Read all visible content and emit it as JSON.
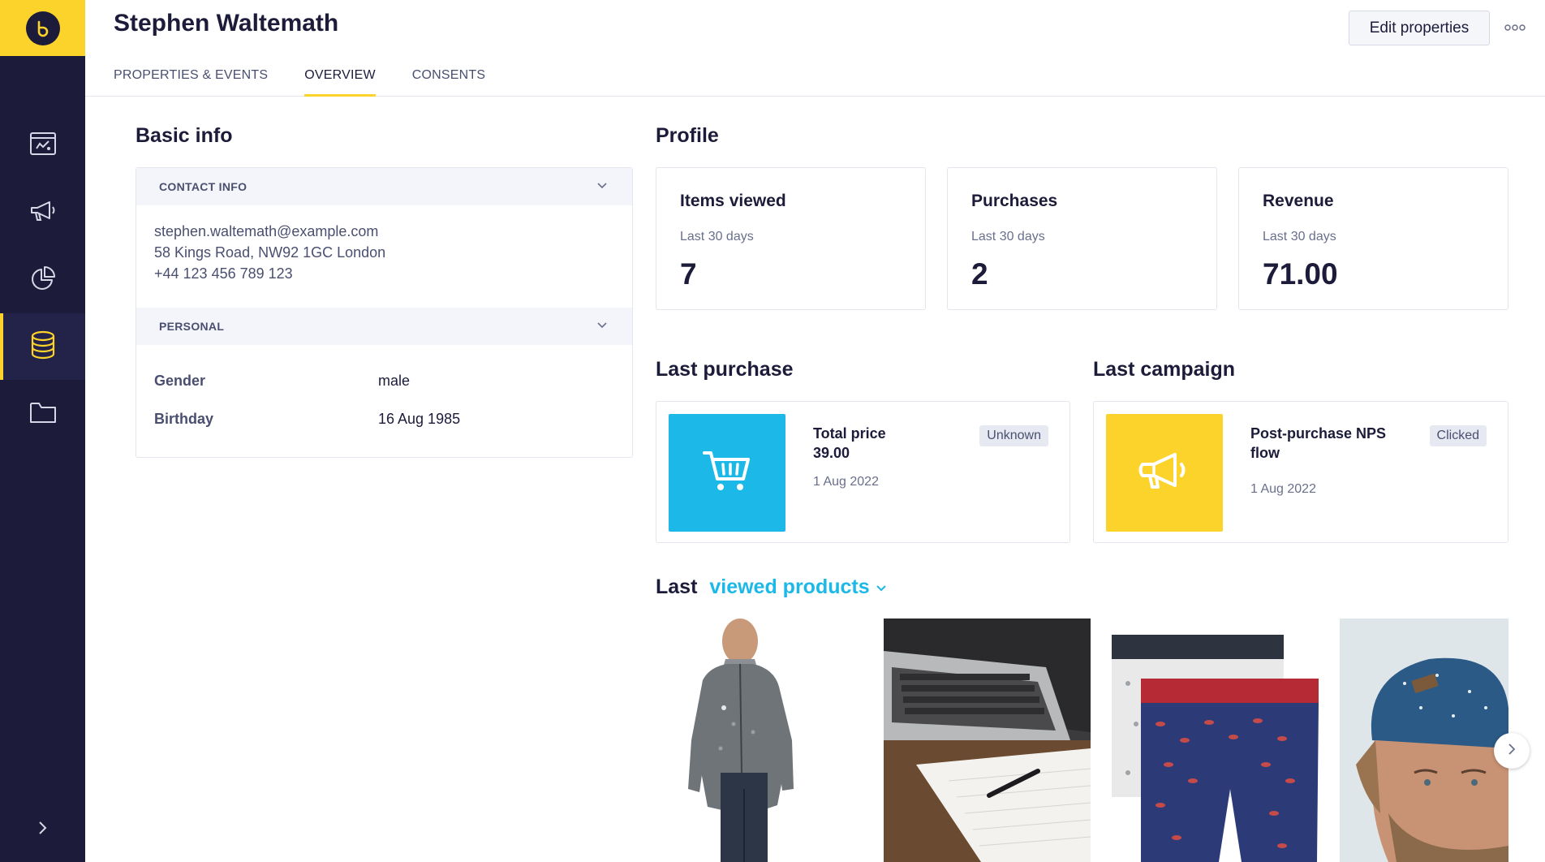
{
  "sidebar": {
    "logo_icon": "b-logo-icon",
    "items": [
      {
        "name": "web-layout-icon",
        "active": false
      },
      {
        "name": "megaphone-icon",
        "active": false
      },
      {
        "name": "pie-chart-icon",
        "active": false
      },
      {
        "name": "database-icon",
        "active": true
      },
      {
        "name": "folder-icon",
        "active": false
      }
    ],
    "expand_icon": "chevron-right-icon"
  },
  "header": {
    "title": "Stephen Waltemath",
    "edit_label": "Edit properties",
    "more_icon": "more-dots-icon",
    "tabs": [
      {
        "label": "PROPERTIES & EVENTS",
        "active": false
      },
      {
        "label": "OVERVIEW",
        "active": true
      },
      {
        "label": "CONSENTS",
        "active": false
      }
    ]
  },
  "basic_info": {
    "title": "Basic info",
    "contact_header": "CONTACT INFO",
    "email": "stephen.waltemath@example.com",
    "address": "58 Kings Road, NW92 1GC London",
    "phone": "+44 123 456 789 123",
    "personal_header": "PERSONAL",
    "gender_label": "Gender",
    "gender_value": "male",
    "birthday_label": "Birthday",
    "birthday_value": "16 Aug 1985"
  },
  "profile": {
    "title": "Profile",
    "cards": [
      {
        "title": "Items viewed",
        "subtitle": "Last 30 days",
        "value": "7"
      },
      {
        "title": "Purchases",
        "subtitle": "Last 30 days",
        "value": "2"
      },
      {
        "title": "Revenue",
        "subtitle": "Last 30 days",
        "value": "71.00"
      }
    ]
  },
  "last_purchase": {
    "title": "Last purchase",
    "line1": "Total price",
    "line2": "39.00",
    "date": "1 Aug 2022",
    "badge": "Unknown",
    "thumb_color": "#1cb8e8",
    "icon": "shopping-cart-icon"
  },
  "last_campaign": {
    "title": "Last campaign",
    "line1": "Post-purchase NPS",
    "line2": "flow",
    "date": "1 Aug 2022",
    "badge": "Clicked",
    "thumb_color": "#fcd32b",
    "icon": "megaphone-icon"
  },
  "viewed_products": {
    "prefix": "Last",
    "link": "viewed products",
    "items": [
      "fleece-jacket-image",
      "laptop-notebook-image",
      "boxer-shorts-image",
      "beanie-man-image"
    ]
  },
  "colors": {
    "accent_yellow": "#fcd32b",
    "accent_blue": "#1cb8e8",
    "sidebar": "#1c1b3a"
  }
}
